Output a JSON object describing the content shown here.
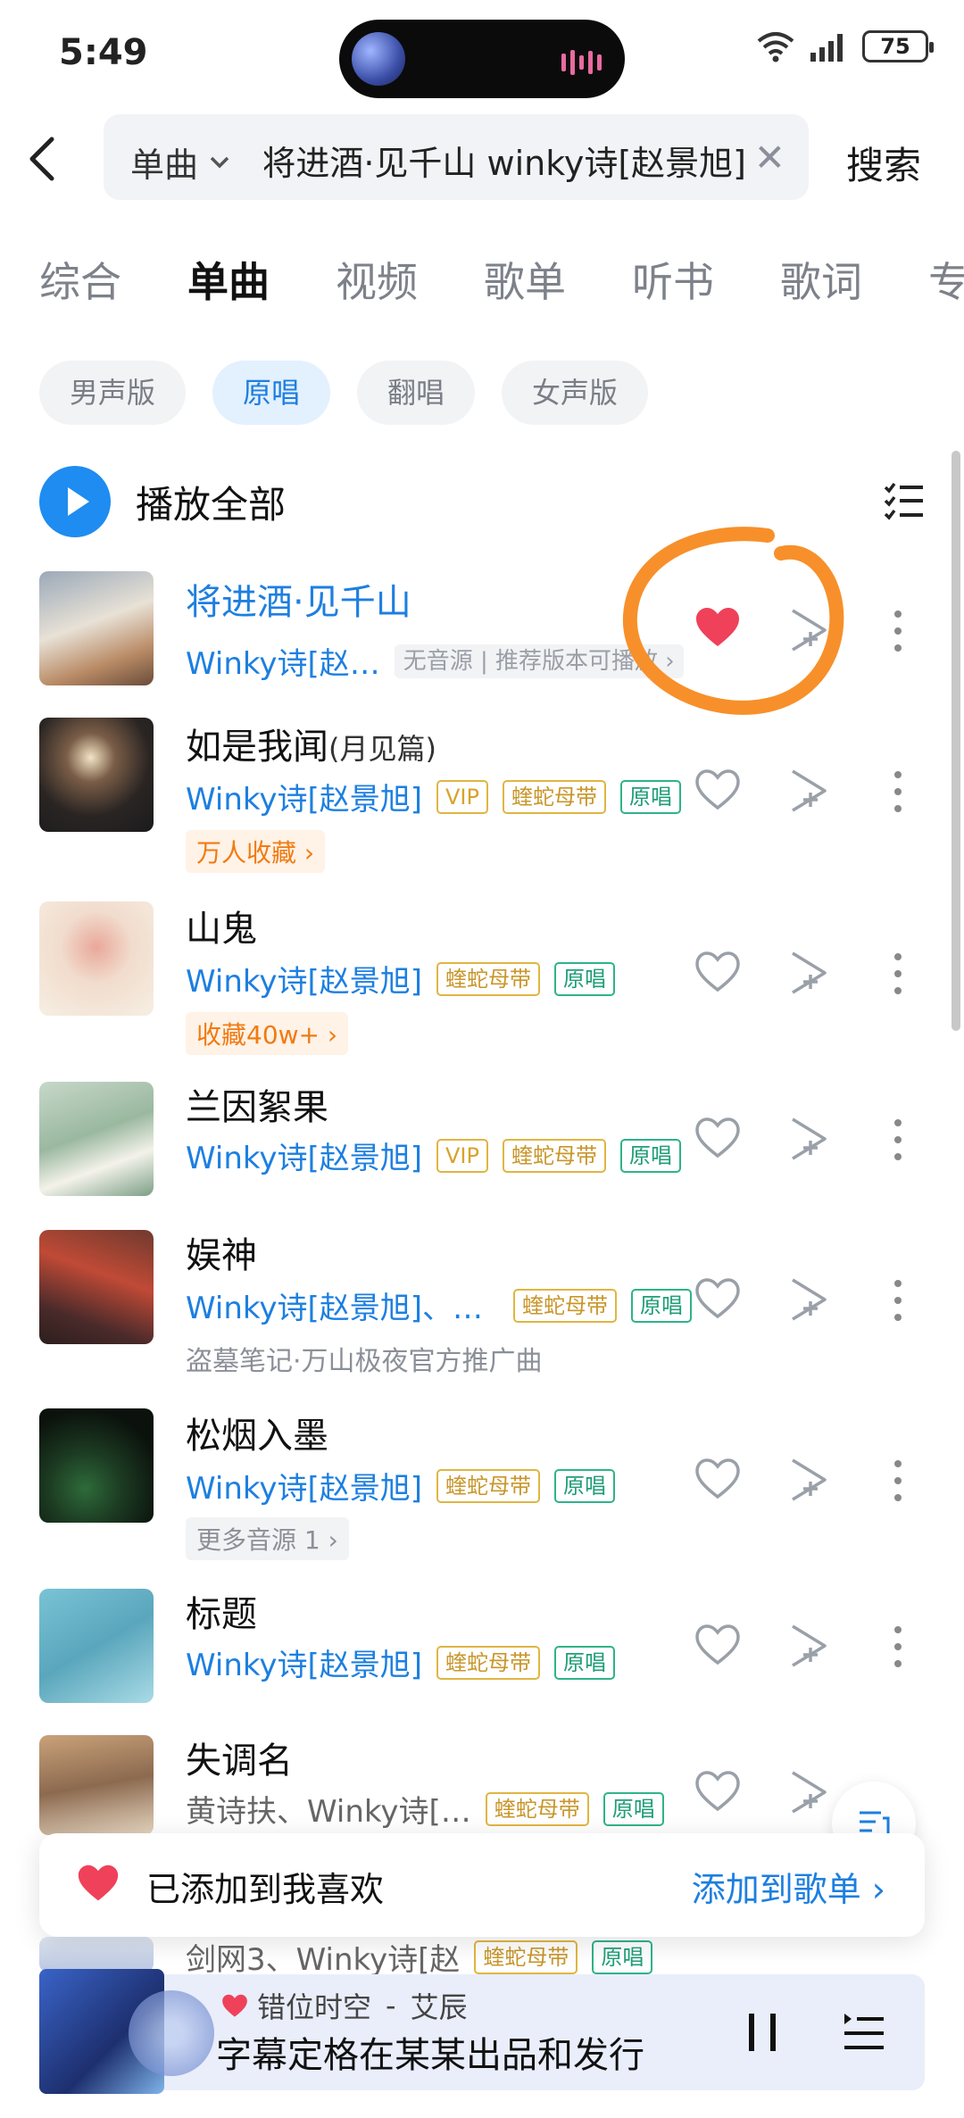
{
  "status_bar": {
    "time": "5:49",
    "battery": "75"
  },
  "search": {
    "scope": "单曲",
    "query": "将进酒·见千山 winky诗[赵景旭]",
    "search_label": "搜索"
  },
  "tabs": [
    "综合",
    "单曲",
    "视频",
    "歌单",
    "听书",
    "歌词",
    "专辑"
  ],
  "active_tab": "单曲",
  "filters": [
    "男声版",
    "原唱",
    "翻唱",
    "女声版"
  ],
  "active_filter": "原唱",
  "play_all_label": "播放全部",
  "songs": [
    {
      "title": "将进酒·见千山",
      "artist": "Winky诗[赵…",
      "tags": [],
      "note": "无音源 | 推荐版本可播放 ›",
      "extra": "",
      "liked": true
    },
    {
      "title": "如是我闻",
      "subtitle": "(月见篇)",
      "artist": "Winky诗[赵景旭]",
      "tags": [
        "VIP",
        "蝰蛇母带",
        "原唱"
      ],
      "extra": "万人收藏 ›",
      "liked": false
    },
    {
      "title": "山鬼",
      "artist": "Winky诗[赵景旭]",
      "tags": [
        "蝰蛇母带",
        "原唱"
      ],
      "extra": "收藏40w+ ›",
      "liked": false
    },
    {
      "title": "兰因絮果",
      "artist": "Winky诗[赵景旭]",
      "tags": [
        "VIP",
        "蝰蛇母带",
        "原唱"
      ],
      "extra": "",
      "liked": false
    },
    {
      "title": "娱神",
      "artist": "Winky诗[赵景旭]、…",
      "tags": [
        "蝰蛇母带",
        "原唱"
      ],
      "extra": "盗墓笔记·万山极夜官方推广曲",
      "liked": false
    },
    {
      "title": "松烟入墨",
      "artist": "Winky诗[赵景旭]",
      "tags": [
        "蝰蛇母带",
        "原唱"
      ],
      "extra": "更多音源 1 ›",
      "liked": false
    },
    {
      "title": "标题",
      "artist": "Winky诗[赵景旭]",
      "tags": [
        "蝰蛇母带",
        "原唱"
      ],
      "extra": "",
      "liked": false
    },
    {
      "title": "失调名",
      "artist": "黄诗扶、Winky诗[…",
      "tags": [
        "蝰蛇母带",
        "原唱"
      ],
      "extra": "",
      "liked": false
    },
    {
      "title": "",
      "artist": "剑网3、Winky诗[赵",
      "tags": [
        "蝰蛇母带",
        "原唱"
      ],
      "extra": "",
      "liked": false
    }
  ],
  "toast": {
    "text": "已添加到我喜欢",
    "action": "添加到歌单 ›"
  },
  "player": {
    "song": "错位时空",
    "artist": "艾辰",
    "separator": "-",
    "lyric": "字幕定格在某某出品和发行"
  },
  "colors": {
    "accent": "#1d7fe0",
    "heart": "#f0415a",
    "annotation": "#f7902a"
  }
}
